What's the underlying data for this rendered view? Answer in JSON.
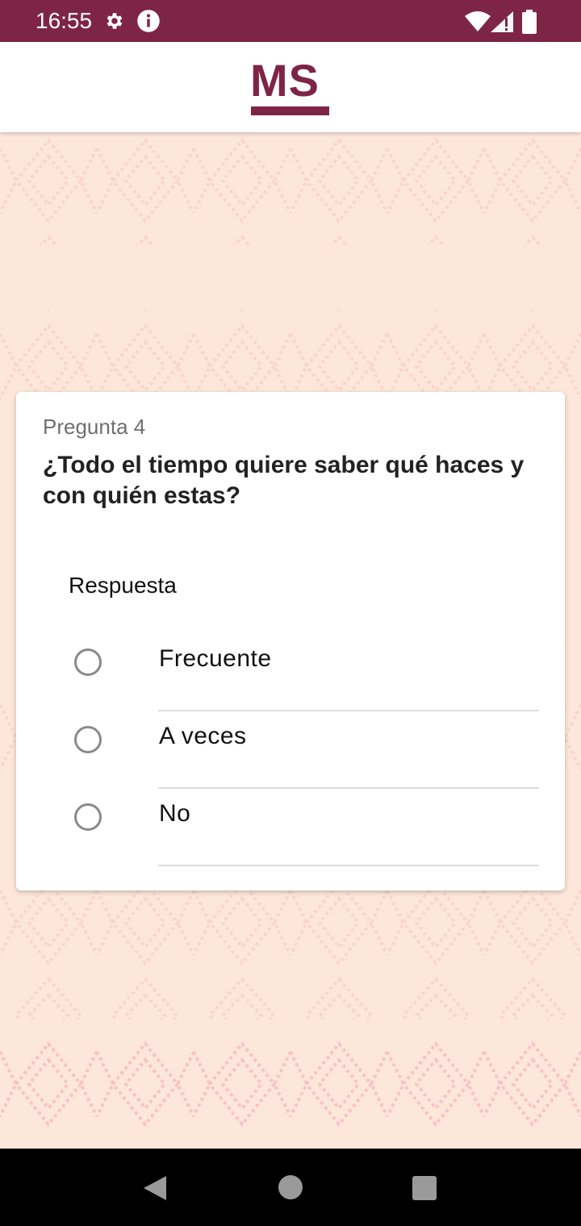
{
  "status_bar": {
    "time": "16:55",
    "icons": [
      "settings-icon",
      "info-icon",
      "wifi-icon",
      "signal-icon",
      "battery-icon"
    ],
    "background": "#7e2547"
  },
  "header": {
    "logo_text": "MS",
    "brand_color": "#7e2547"
  },
  "question": {
    "number_label": "Pregunta 4",
    "text": "¿Todo el tiempo quiere saber qué haces y con quién estas?",
    "answer_label": "Respuesta",
    "options": [
      {
        "label": "Frecuente",
        "selected": false
      },
      {
        "label": "A veces",
        "selected": false
      },
      {
        "label": "No",
        "selected": false
      }
    ]
  },
  "nav_bar": {
    "buttons": [
      "back-icon",
      "home-icon",
      "recents-icon"
    ]
  }
}
